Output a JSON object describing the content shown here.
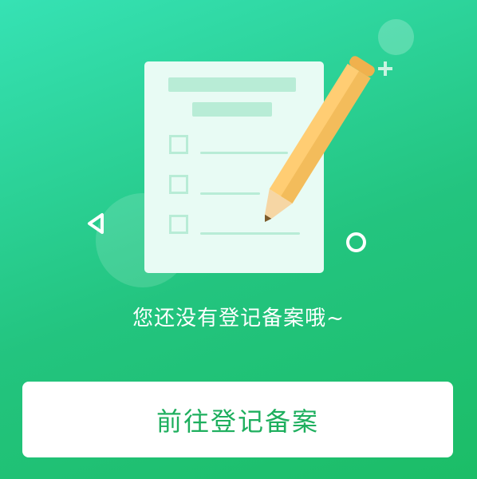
{
  "empty_state": {
    "message": "您还没有登记备案哦~",
    "illustration": {
      "name": "checklist-with-pencil",
      "icons": [
        "document-icon",
        "pencil-icon",
        "plus-icon",
        "ring-icon",
        "triangle-icon"
      ]
    }
  },
  "actions": {
    "go_register_label": "前往登记备案"
  },
  "colors": {
    "background_start": "#36e2b4",
    "background_end": "#1cbd67",
    "button_text": "#1eaf5e",
    "pencil": "#ffcd73",
    "document": "#e8fbf4"
  }
}
